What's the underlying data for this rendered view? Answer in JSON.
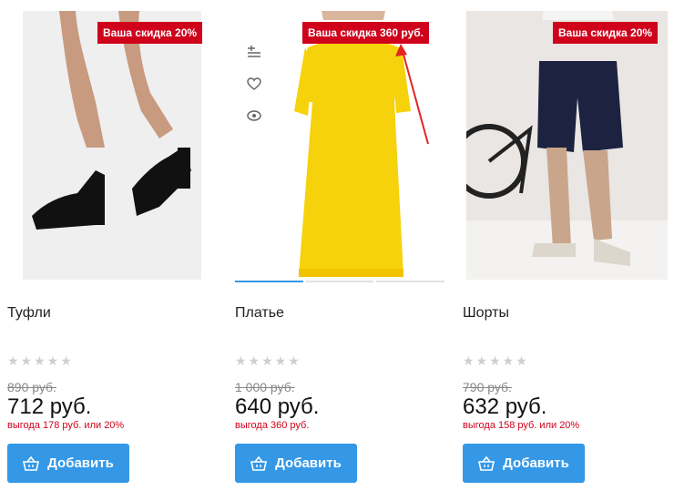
{
  "colors": {
    "accent": "#3498e6",
    "discount": "#d0021b",
    "badge": "#d0021b"
  },
  "products": [
    {
      "title": "Туфли",
      "badge": "Ваша скидка 20%",
      "old_price": "890 руб.",
      "price": "712 руб.",
      "savings": "выгода 178 руб. или 20%",
      "rating_stars": "★★★★★",
      "button": "Добавить",
      "image": "black heeled shoes"
    },
    {
      "title": "Платье",
      "badge": "Ваша скидка 360 руб.",
      "old_price": "1 000 руб.",
      "price": "640 руб.",
      "savings": "выгода 360 руб.",
      "rating_stars": "★★★★★",
      "button": "Добавить",
      "image": "yellow dress"
    },
    {
      "title": "Шорты",
      "badge": "Ваша скидка 20%",
      "old_price": "790 руб.",
      "price": "632 руб.",
      "savings": "выгода 158 руб. или 20%",
      "rating_stars": "★★★★★",
      "button": "Добавить",
      "image": "navy shorts"
    }
  ],
  "quick_actions": [
    "compare-icon",
    "heart-icon",
    "eye-icon"
  ]
}
